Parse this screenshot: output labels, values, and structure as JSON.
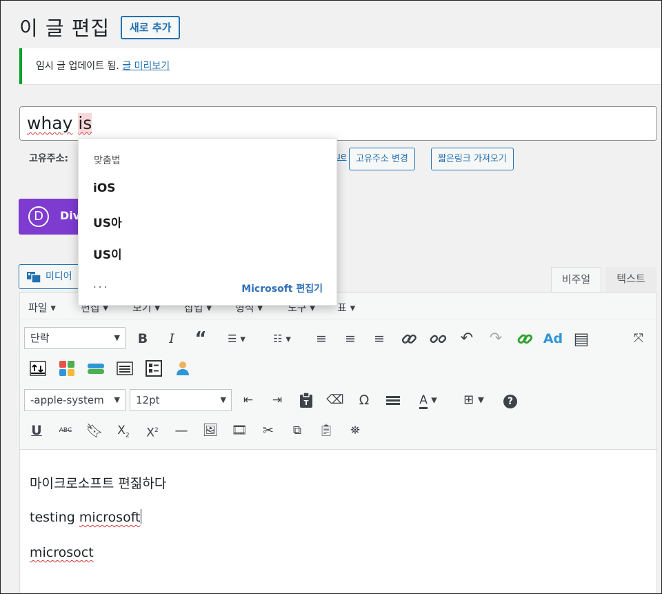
{
  "header": {
    "title": "이 글 편집",
    "add_new": "새로 추가"
  },
  "notice": {
    "text": "임시 글 업데이트 됨.",
    "link": "글 미리보기"
  },
  "post_title": {
    "word1": "whay",
    "word2": "is"
  },
  "permalink": {
    "label": "고유주소:",
    "tail": "ue",
    "edit_button": "고유주소 변경",
    "shortlink_button": "짧은링크 가져오기"
  },
  "divi": {
    "logo": "D",
    "label": "Divi"
  },
  "media": {
    "label": "미디어"
  },
  "editor_tabs": {
    "visual": "비주얼",
    "text": "텍스트"
  },
  "menubar": {
    "items": [
      {
        "label": "파일"
      },
      {
        "label": "편집"
      },
      {
        "label": "보기"
      },
      {
        "label": "삽입"
      },
      {
        "label": "형식"
      },
      {
        "label": "도구"
      },
      {
        "label": "표"
      }
    ]
  },
  "toolbar": {
    "format_select": "단락",
    "font_select": "-apple-system",
    "size_select": "12pt",
    "icons": [
      "bold-icon",
      "italic-icon",
      "blockquote-icon",
      "bullet-list-icon",
      "numbered-list-icon",
      "align-left-icon",
      "align-center-icon",
      "align-right-icon",
      "link-icon",
      "unlink-icon",
      "undo-icon",
      "redo-icon",
      "insert-link-icon",
      "ad-icon",
      "table-list-icon",
      "fullscreen-icon"
    ],
    "ad_label": "Ad"
  },
  "content": {
    "line1": "마이크로소프트 편짊하다",
    "line2_a": "testing ",
    "line2_b": "microsoft",
    "line3": "microsoct"
  },
  "spell_popup": {
    "heading": "맞춤법",
    "suggestions": [
      "iOS",
      "US아",
      "US이"
    ],
    "more": "...",
    "brand": "Microsoft 편집기"
  },
  "colors": {
    "accent": "#2271b1",
    "notice_border": "#00a32a",
    "divi": "#7e3bd0",
    "brand": "#2f6fb8"
  }
}
